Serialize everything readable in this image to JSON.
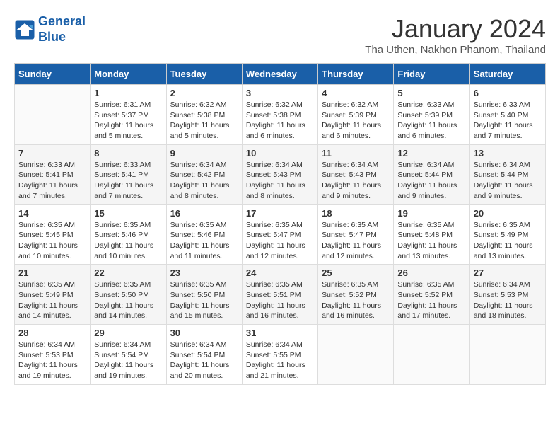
{
  "header": {
    "logo_line1": "General",
    "logo_line2": "Blue",
    "month_title": "January 2024",
    "location": "Tha Uthen, Nakhon Phanom, Thailand"
  },
  "days_of_week": [
    "Sunday",
    "Monday",
    "Tuesday",
    "Wednesday",
    "Thursday",
    "Friday",
    "Saturday"
  ],
  "weeks": [
    [
      {
        "day": "",
        "content": ""
      },
      {
        "day": "1",
        "content": "Sunrise: 6:31 AM\nSunset: 5:37 PM\nDaylight: 11 hours and 5 minutes."
      },
      {
        "day": "2",
        "content": "Sunrise: 6:32 AM\nSunset: 5:38 PM\nDaylight: 11 hours and 5 minutes."
      },
      {
        "day": "3",
        "content": "Sunrise: 6:32 AM\nSunset: 5:38 PM\nDaylight: 11 hours and 6 minutes."
      },
      {
        "day": "4",
        "content": "Sunrise: 6:32 AM\nSunset: 5:39 PM\nDaylight: 11 hours and 6 minutes."
      },
      {
        "day": "5",
        "content": "Sunrise: 6:33 AM\nSunset: 5:39 PM\nDaylight: 11 hours and 6 minutes."
      },
      {
        "day": "6",
        "content": "Sunrise: 6:33 AM\nSunset: 5:40 PM\nDaylight: 11 hours and 7 minutes."
      }
    ],
    [
      {
        "day": "7",
        "content": "Sunrise: 6:33 AM\nSunset: 5:41 PM\nDaylight: 11 hours and 7 minutes."
      },
      {
        "day": "8",
        "content": "Sunrise: 6:33 AM\nSunset: 5:41 PM\nDaylight: 11 hours and 7 minutes."
      },
      {
        "day": "9",
        "content": "Sunrise: 6:34 AM\nSunset: 5:42 PM\nDaylight: 11 hours and 8 minutes."
      },
      {
        "day": "10",
        "content": "Sunrise: 6:34 AM\nSunset: 5:43 PM\nDaylight: 11 hours and 8 minutes."
      },
      {
        "day": "11",
        "content": "Sunrise: 6:34 AM\nSunset: 5:43 PM\nDaylight: 11 hours and 9 minutes."
      },
      {
        "day": "12",
        "content": "Sunrise: 6:34 AM\nSunset: 5:44 PM\nDaylight: 11 hours and 9 minutes."
      },
      {
        "day": "13",
        "content": "Sunrise: 6:34 AM\nSunset: 5:44 PM\nDaylight: 11 hours and 9 minutes."
      }
    ],
    [
      {
        "day": "14",
        "content": "Sunrise: 6:35 AM\nSunset: 5:45 PM\nDaylight: 11 hours and 10 minutes."
      },
      {
        "day": "15",
        "content": "Sunrise: 6:35 AM\nSunset: 5:46 PM\nDaylight: 11 hours and 10 minutes."
      },
      {
        "day": "16",
        "content": "Sunrise: 6:35 AM\nSunset: 5:46 PM\nDaylight: 11 hours and 11 minutes."
      },
      {
        "day": "17",
        "content": "Sunrise: 6:35 AM\nSunset: 5:47 PM\nDaylight: 11 hours and 12 minutes."
      },
      {
        "day": "18",
        "content": "Sunrise: 6:35 AM\nSunset: 5:47 PM\nDaylight: 11 hours and 12 minutes."
      },
      {
        "day": "19",
        "content": "Sunrise: 6:35 AM\nSunset: 5:48 PM\nDaylight: 11 hours and 13 minutes."
      },
      {
        "day": "20",
        "content": "Sunrise: 6:35 AM\nSunset: 5:49 PM\nDaylight: 11 hours and 13 minutes."
      }
    ],
    [
      {
        "day": "21",
        "content": "Sunrise: 6:35 AM\nSunset: 5:49 PM\nDaylight: 11 hours and 14 minutes."
      },
      {
        "day": "22",
        "content": "Sunrise: 6:35 AM\nSunset: 5:50 PM\nDaylight: 11 hours and 14 minutes."
      },
      {
        "day": "23",
        "content": "Sunrise: 6:35 AM\nSunset: 5:50 PM\nDaylight: 11 hours and 15 minutes."
      },
      {
        "day": "24",
        "content": "Sunrise: 6:35 AM\nSunset: 5:51 PM\nDaylight: 11 hours and 16 minutes."
      },
      {
        "day": "25",
        "content": "Sunrise: 6:35 AM\nSunset: 5:52 PM\nDaylight: 11 hours and 16 minutes."
      },
      {
        "day": "26",
        "content": "Sunrise: 6:35 AM\nSunset: 5:52 PM\nDaylight: 11 hours and 17 minutes."
      },
      {
        "day": "27",
        "content": "Sunrise: 6:34 AM\nSunset: 5:53 PM\nDaylight: 11 hours and 18 minutes."
      }
    ],
    [
      {
        "day": "28",
        "content": "Sunrise: 6:34 AM\nSunset: 5:53 PM\nDaylight: 11 hours and 19 minutes."
      },
      {
        "day": "29",
        "content": "Sunrise: 6:34 AM\nSunset: 5:54 PM\nDaylight: 11 hours and 19 minutes."
      },
      {
        "day": "30",
        "content": "Sunrise: 6:34 AM\nSunset: 5:54 PM\nDaylight: 11 hours and 20 minutes."
      },
      {
        "day": "31",
        "content": "Sunrise: 6:34 AM\nSunset: 5:55 PM\nDaylight: 11 hours and 21 minutes."
      },
      {
        "day": "",
        "content": ""
      },
      {
        "day": "",
        "content": ""
      },
      {
        "day": "",
        "content": ""
      }
    ]
  ]
}
